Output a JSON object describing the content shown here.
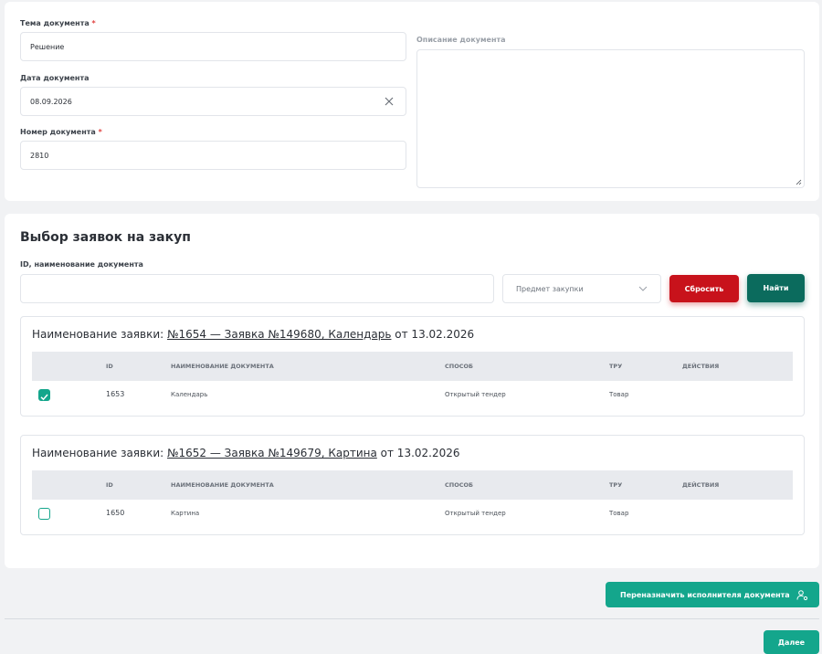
{
  "document_form": {
    "topic_label": "Тема документа",
    "topic_value": "Решение",
    "date_label": "Дата документа",
    "date_value": "08.09.2026",
    "number_label": "Номер документа",
    "number_value": "2810",
    "description_label": "Описание документа",
    "required_mark": "*"
  },
  "selection": {
    "title": "Выбор заявок на закуп",
    "search_label": "ID, наименование документа",
    "search_value": "",
    "subject_placeholder": "Предмет закупки",
    "reset_label": "Сбросить",
    "find_label": "Найти"
  },
  "requests": [
    {
      "title_prefix": "Наименование заявки:",
      "link_text": "№1654 — Заявка №149680, Календарь",
      "date_text": "от 13.02.2026",
      "columns": [
        "ID",
        "НАИМЕНОВАНИЕ ДОКУМЕНТА",
        "СПОСОБ",
        "ТРУ",
        "ДЕЙСТВИЯ"
      ],
      "row": {
        "checked": true,
        "id": "1653",
        "name": "Календарь",
        "method": "Открытый тендер",
        "tru": "Товар",
        "actions": ""
      }
    },
    {
      "title_prefix": "Наименование заявки:",
      "link_text": "№1652 — Заявка №149679, Картина",
      "date_text": "от 13.02.2026",
      "columns": [
        "ID",
        "НАИМЕНОВАНИЕ ДОКУМЕНТА",
        "СПОСОБ",
        "ТРУ",
        "ДЕЙСТВИЯ"
      ],
      "row": {
        "checked": false,
        "id": "1650",
        "name": "Картина",
        "method": "Открытый тендер",
        "tru": "Товар",
        "actions": ""
      }
    }
  ],
  "footer": {
    "reassign_label": "Переназначить исполнителя документа",
    "next_label": "Далее"
  },
  "icons": {
    "clear": "close-icon",
    "chevron": "chevron-down-icon",
    "checkbox_checked": "checkmark-icon",
    "reassign": "user-settings-icon",
    "resize": "resize-handle-icon"
  },
  "colors": {
    "accent_teal": "#14a68c",
    "dark_teal": "#0b6b5d",
    "danger_red": "#c8121b",
    "required_red": "#e0413f"
  }
}
